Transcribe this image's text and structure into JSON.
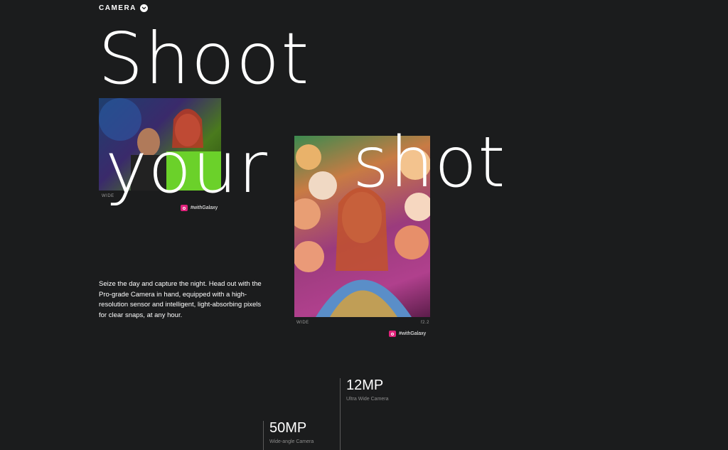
{
  "section": {
    "label": "CAMERA",
    "icon": "chevron-down-icon"
  },
  "headline": {
    "line1": "Shoot",
    "line2": "your",
    "line3": "shot"
  },
  "photos": [
    {
      "caption_left": "WIDE",
      "caption_right": "",
      "tag": "#withGalaxy",
      "tag_icon": "camera-icon"
    },
    {
      "caption_left": "WIDE",
      "caption_right": "f2.2",
      "tag": "#withGalaxy",
      "tag_icon": "camera-icon"
    }
  ],
  "description": "Seize the day and capture the night. Head out with the Pro-grade Camera in hand, equipped with a high-resolution sensor and intelligent, light-absorbing pixels for clear snaps, at any hour.",
  "specs": [
    {
      "value": "12MP",
      "label": "Ultra Wide Camera"
    },
    {
      "value": "50MP",
      "label": "Wide-angle Camera"
    }
  ],
  "colors": {
    "background": "#1b1c1d",
    "tag_accent": "#e0227b"
  }
}
